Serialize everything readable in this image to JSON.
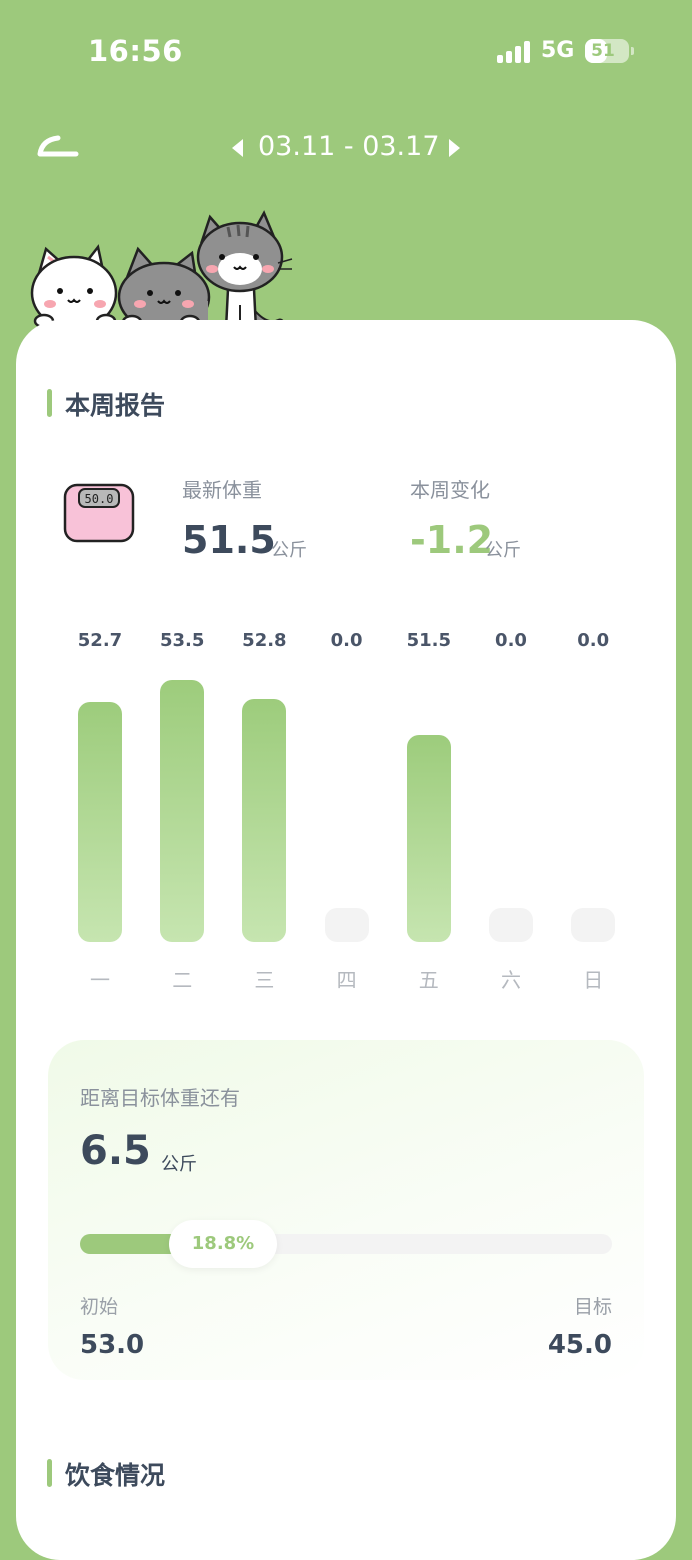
{
  "status_bar": {
    "time": "16:56",
    "network": "5G",
    "battery": "51",
    "battery_level": 0.51
  },
  "header": {
    "week_range": "03.11 - 03.17"
  },
  "weekly_report": {
    "title": "本周报告",
    "scale_display": "50.0",
    "latest_weight": {
      "label": "最新体重",
      "value": "51.5",
      "unit": "公斤"
    },
    "weekly_change": {
      "label": "本周变化",
      "value": "-1.2",
      "unit": "公斤"
    }
  },
  "chart_data": {
    "type": "bar",
    "categories": [
      "一",
      "二",
      "三",
      "四",
      "五",
      "六",
      "日"
    ],
    "values": [
      52.7,
      53.5,
      52.8,
      0.0,
      51.5,
      0.0,
      0.0
    ],
    "value_labels": [
      "52.7",
      "53.5",
      "52.8",
      "0.0",
      "51.5",
      "0.0",
      "0.0"
    ],
    "title": "",
    "xlabel": "",
    "ylabel": ""
  },
  "goal": {
    "label": "距离目标体重还有",
    "remaining": "6.5",
    "unit": "公斤",
    "progress_text": "18.8%",
    "progress": 0.188,
    "start_label": "初始",
    "start_value": "53.0",
    "target_label": "目标",
    "target_value": "45.0"
  },
  "diet": {
    "title": "饮食情况"
  },
  "colors": {
    "accent": "#9dc97c",
    "text_dark": "#3d4a5c",
    "text_muted": "#8a919c"
  }
}
